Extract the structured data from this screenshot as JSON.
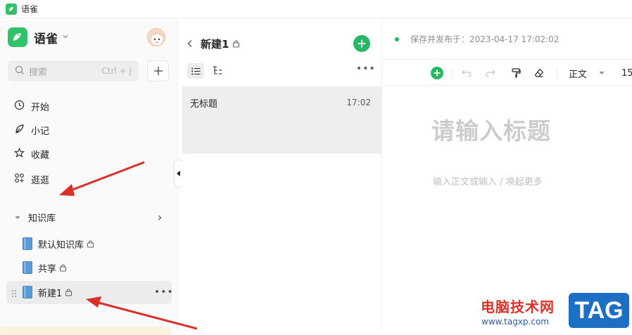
{
  "window": {
    "title": "语雀"
  },
  "sidebar": {
    "brand": "语雀",
    "search": {
      "placeholder": "搜索",
      "shortcut": "Ctrl + J"
    },
    "nav": [
      {
        "label": "开始",
        "icon": "clock-icon"
      },
      {
        "label": "小记",
        "icon": "feather-icon"
      },
      {
        "label": "收藏",
        "icon": "star-icon"
      },
      {
        "label": "逛逛",
        "icon": "grid-icon"
      }
    ],
    "section": {
      "label": "知识库"
    },
    "knowledge_bases": [
      {
        "label": "默认知识库",
        "locked": true
      },
      {
        "label": "共享",
        "locked": true
      },
      {
        "label": "新建1",
        "locked": true,
        "active": true
      }
    ]
  },
  "doc_list": {
    "title": "新建1",
    "docs": [
      {
        "name": "无标题",
        "time": "17:02"
      }
    ]
  },
  "editor": {
    "status": "保存并发布于：2023-04-17 17:02:02",
    "toolbar": {
      "style": "正文",
      "font_size": "15"
    },
    "title_placeholder": "请输入标题",
    "body_placeholder": "输入正文或输入 / 唤起更多"
  },
  "watermark": {
    "text": "电脑技术网",
    "url": "www.tagxp.com",
    "tag": "TAG"
  },
  "colors": {
    "brand_green": "#25b864",
    "annotation_red": "#d9302a",
    "book_blue": "#5b9bd5"
  }
}
